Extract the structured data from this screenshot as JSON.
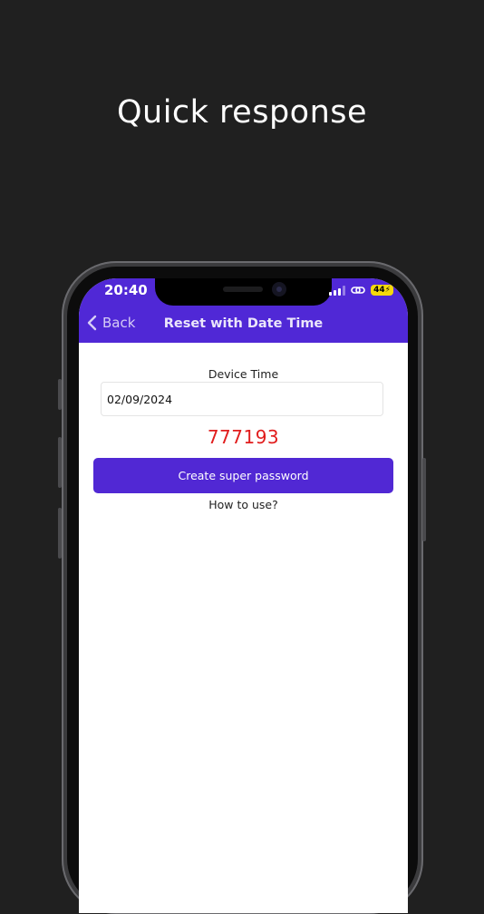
{
  "promo": {
    "headline": "Quick response"
  },
  "status_bar": {
    "time": "20:40",
    "battery": "44"
  },
  "nav": {
    "back_label": "Back",
    "title": "Reset with Date Time"
  },
  "form": {
    "device_time_label": "Device Time",
    "date_value": "02/09/2024",
    "super_code": "777193",
    "create_button_label": "Create super password",
    "how_to_label": "How to use?"
  },
  "colors": {
    "accent": "#5028d6",
    "code": "#e11d1d",
    "background": "#202020"
  },
  "icons": {
    "back": "chevron-left-icon",
    "signal": "cellular-signal-icon",
    "link": "link-icon",
    "battery": "battery-charging-icon"
  }
}
